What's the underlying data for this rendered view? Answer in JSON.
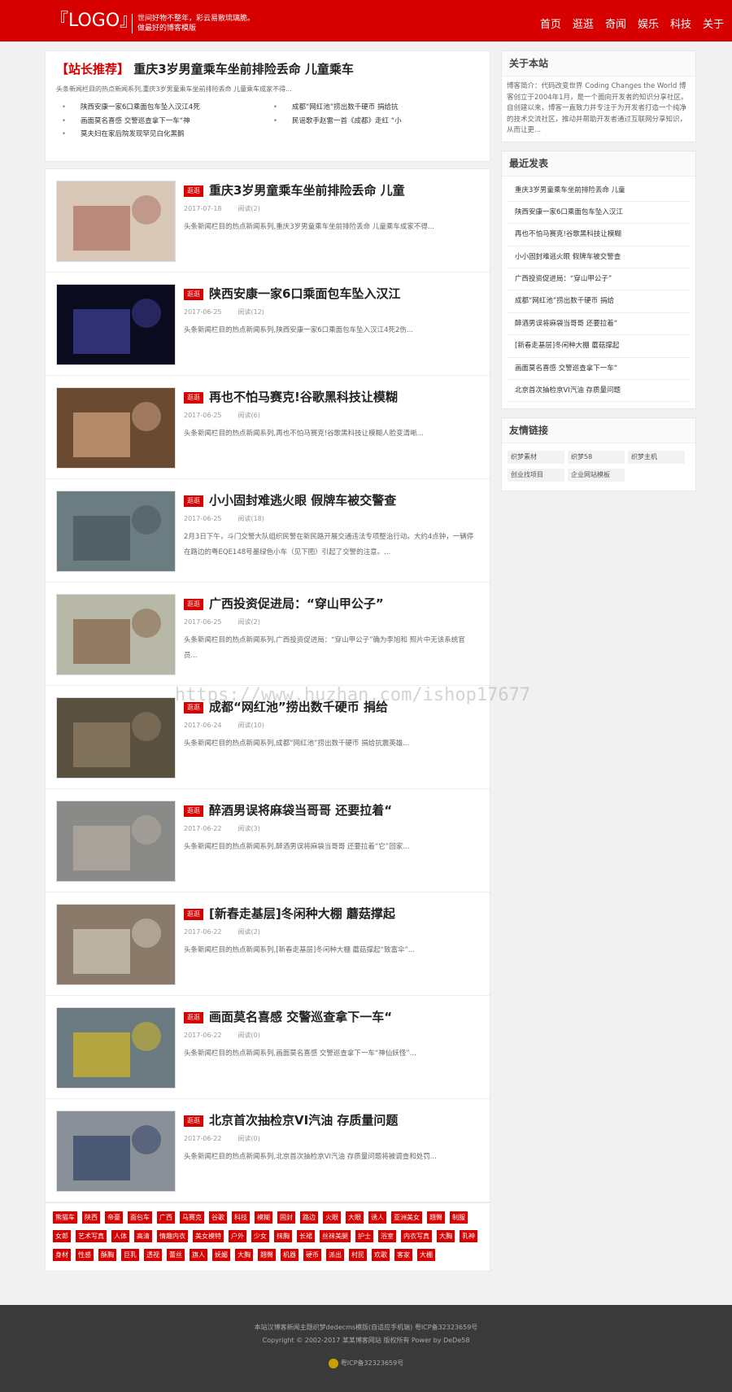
{
  "header": {
    "logo": "『LOGO』",
    "slogan_line1": "世间好物不整年，彩云易散琉璃脆。",
    "slogan_line2": "做最好的博客模版",
    "nav": [
      "首页",
      "逛逛",
      "奇闻",
      "娱乐",
      "科技",
      "关于"
    ]
  },
  "recommend": {
    "tag": "【站长推荐】",
    "title": "重庆3岁男童乘车坐前排险丢命 儿童乘车",
    "desc": "头条新闻栏目的热点新闻系列,重庆3岁男童乘车坐前排险丢命 儿童乘车成家不得...",
    "items": [
      "陕西安康一家6口乘面包车坠入汉江4死",
      "成都“网红池”捞出数千硬币 捐给抗",
      "画面莫名喜感 交警巡查拿下一车“神",
      "民谣歌手赵雷一首《成都》走红 “小",
      "莫夫妇在家后院发现罕见白化黑鹅"
    ]
  },
  "articles": [
    {
      "cat": "逛逛",
      "title": "重庆3岁男童乘车坐前排险丢命 儿童",
      "date": "2017-07-18",
      "reads": "阅读(2)",
      "excerpt": "头条新闻栏目的热点新闻系列,重庆3岁男童乘车坐前排险丢命 儿童乘车成家不得..."
    },
    {
      "cat": "逛逛",
      "title": "陕西安康一家6口乘面包车坠入汉江",
      "date": "2017-06-25",
      "reads": "阅读(12)",
      "excerpt": "头条新闻栏目的热点新闻系列,陕西安康一家6口乘面包车坠入汉江4死2伤..."
    },
    {
      "cat": "逛逛",
      "title": "再也不怕马赛克!谷歌黑科技让模糊",
      "date": "2017-06-25",
      "reads": "阅读(6)",
      "excerpt": "头条新闻栏目的热点新闻系列,再也不怕马赛克!谷歌黑科技让模糊人脸变清晰..."
    },
    {
      "cat": "逛逛",
      "title": "小小固封难逃火眼 假牌车被交警查",
      "date": "2017-06-25",
      "reads": "阅读(18)",
      "excerpt": "2月3日下午，斗门交警大队组织民警在新民路开展交通违法专项整治行动。大约4点钟，一辆停在路边的粤EQE148号墨绿色小车（见下图）引起了交警的注意。..."
    },
    {
      "cat": "逛逛",
      "title": "广西投资促进局：“穿山甲公子”",
      "date": "2017-06-25",
      "reads": "阅读(2)",
      "excerpt": "头条新闻栏目的热点新闻系列,广西投资促进局：“穿山甲公子”确为李旭和 照片中无该系统官员..."
    },
    {
      "cat": "逛逛",
      "title": "成都“网红池”捞出数千硬币 捐给",
      "date": "2017-06-24",
      "reads": "阅读(10)",
      "excerpt": "头条新闻栏目的热点新闻系列,成都“网红池”捞出数千硬币 捐给抗震英雄..."
    },
    {
      "cat": "逛逛",
      "title": "醉酒男误将麻袋当哥哥 还要拉着“",
      "date": "2017-06-22",
      "reads": "阅读(3)",
      "excerpt": "头条新闻栏目的热点新闻系列,醉酒男误将麻袋当哥哥 还要拉着“它”回家..."
    },
    {
      "cat": "逛逛",
      "title": "[新春走基层]冬闲种大棚 蘑菇撑起",
      "date": "2017-06-22",
      "reads": "阅读(2)",
      "excerpt": "头条新闻栏目的热点新闻系列,[新春走基层]冬闲种大棚 蘑菇撑起“致富伞”..."
    },
    {
      "cat": "逛逛",
      "title": "画面莫名喜感 交警巡查拿下一车“",
      "date": "2017-06-22",
      "reads": "阅读(0)",
      "excerpt": "头条新闻栏目的热点新闻系列,画面莫名喜感 交警巡查拿下一车“神仙妖怪”..."
    },
    {
      "cat": "逛逛",
      "title": "北京首次抽检京VI汽油 存质量问题",
      "date": "2017-06-22",
      "reads": "阅读(0)",
      "excerpt": "头条新闻栏目的热点新闻系列,北京首次抽检京VI汽油 存质量问题将被调查和处罚..."
    }
  ],
  "tags": [
    "熊猫车",
    "陕西",
    "帝豪",
    "面包车",
    "广西",
    "马赛克",
    "谷歌",
    "科技",
    "模糊",
    "固封",
    "路边",
    "火眼",
    "大眼",
    "诱人",
    "亚洲美女",
    "翘臀",
    "制服",
    "女郎",
    "艺术写真",
    "人体",
    "高清",
    "情趣内衣",
    "美女模特",
    "户外",
    "少女",
    "抹胸",
    "长裙",
    "丝袜美腿",
    "护士",
    "浴室",
    "内衣写真",
    "大胸",
    "乳神",
    "身材",
    "性感",
    "酥胸",
    "巨乳",
    "透视",
    "蕾丝",
    "旗人",
    "妩媚",
    "大胸",
    "翘臀",
    "机器",
    "硬币",
    "派出",
    "村民",
    "欢歌",
    "客家",
    "大棚"
  ],
  "about": {
    "title": "关于本站",
    "text": "博客简介：代码改变世界 Coding Changes the World 博客创立于2004年1月，是一个面向开发者的知识分享社区。自创建以来，博客一直致力并专注于为开发者打造一个纯净的技术交流社区，推动并帮助开发者通过互联网分享知识，从而让更..."
  },
  "recent": {
    "title": "最近发表",
    "items": [
      "重庆3岁男童乘车坐前排险丢命 儿童",
      "陕西安康一家6口乘面包车坠入汉江",
      "再也不怕马赛克!谷歌黑科技让模糊",
      "小小固封难逃火眼 假牌车被交警查",
      "广西投资促进局：“穿山甲公子”",
      "成都“网红池”捞出数千硬币 捐给",
      "醉酒男误将麻袋当哥哥 还要拉着“",
      "[新春走基层]冬闲种大棚 蘑菇撑起",
      "画面莫名喜感 交警巡查拿下一车“",
      "北京首次抽检京VI汽油 存质量问题"
    ]
  },
  "friends": {
    "title": "友情链接",
    "items": [
      "织梦素材",
      "织梦58",
      "织梦主机",
      "创业找项目",
      "企业网站模板"
    ]
  },
  "footer": {
    "line1": "本站汉博客新闻主题织梦dedecms模版(自适应手机端) 粤ICP备32323659号",
    "line2": "Copyright © 2002-2017 某某博客网站 版权所有 Power by DeDe58",
    "line3": "粤ICP备32323659号"
  },
  "watermark": "https://www.huzhan.com/ishop17677",
  "colors": {
    "brand": "#d60000",
    "footer": "#3a3a3a"
  }
}
